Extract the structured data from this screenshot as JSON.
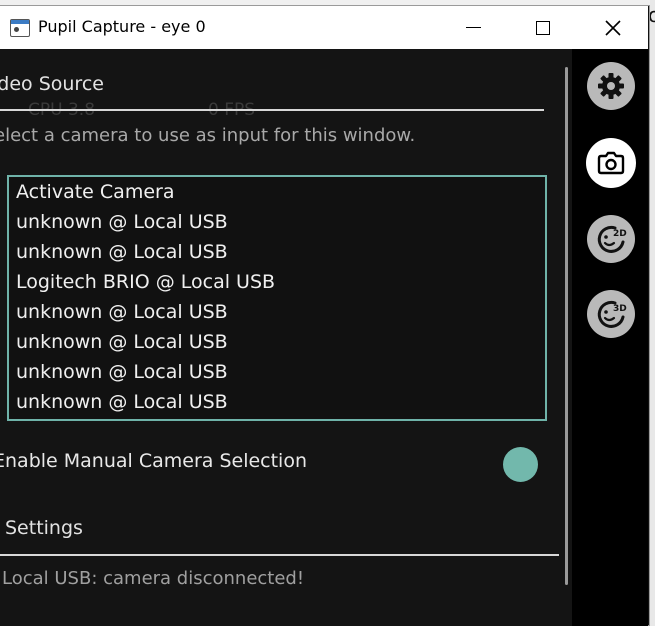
{
  "window": {
    "title": "Pupil Capture - eye 0"
  },
  "background_window": {
    "visible_letter": "o"
  },
  "overlay": {
    "cpu": "CPU 3.8",
    "fps": "0 FPS"
  },
  "video_source": {
    "title": "ideo Source",
    "help_text": "elect a camera to use as input for this window.",
    "camera_list": [
      "Activate Camera",
      "unknown @ Local USB",
      "unknown @ Local USB",
      "Logitech BRIO @ Local USB",
      "unknown @ Local USB",
      "unknown @ Local USB",
      "unknown @ Local USB",
      "unknown @ Local USB"
    ],
    "manual_selection_label": "Enable Manual Camera Selection",
    "manual_selection_enabled": true
  },
  "settings": {
    "title": "Settings",
    "status_message": "Local USB: camera disconnected!"
  },
  "sidebar": {
    "buttons": [
      {
        "icon": "gear-icon",
        "active": false
      },
      {
        "icon": "camera-icon",
        "active": true
      },
      {
        "icon": "detector-2d-icon",
        "badge": "2D",
        "active": false
      },
      {
        "icon": "detector-3d-icon",
        "badge": "3D",
        "active": false
      }
    ]
  },
  "colors": {
    "accent": "#6fb3a9",
    "toggle_on": "#72b8ac",
    "content_bg": "#141414",
    "sidebar_bg": "#000000"
  }
}
